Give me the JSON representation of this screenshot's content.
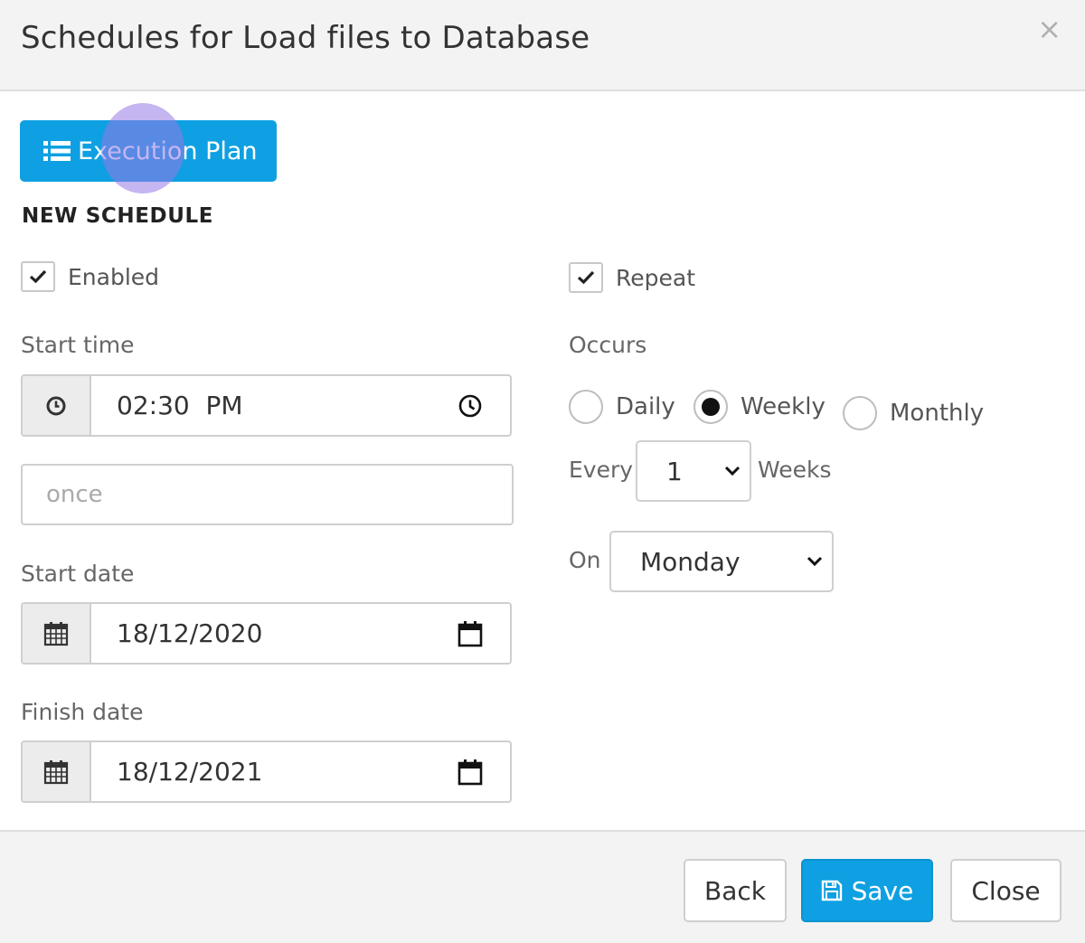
{
  "dialog": {
    "title": "Schedules for Load files to Database",
    "close_symbol": "×"
  },
  "toolbar": {
    "execution_plan_label": "Execution Plan",
    "execution_plan_icon": "list-icon"
  },
  "section": {
    "title": "NEW SCHEDULE"
  },
  "left": {
    "enabled_label": "Enabled",
    "enabled_checked": true,
    "start_time_label": "Start time",
    "start_time_value": "02:30  PM",
    "frequency_placeholder": "once",
    "start_date_label": "Start date",
    "start_date_value": "18/12/2020",
    "finish_date_label": "Finish date",
    "finish_date_value": "18/12/2021"
  },
  "right": {
    "repeat_label": "Repeat",
    "repeat_checked": true,
    "occurs_label": "Occurs",
    "options": [
      "Daily",
      "Weekly",
      "Monthly"
    ],
    "selected_option": "Weekly",
    "every_label": "Every",
    "every_value": "1",
    "weeks_label": "Weeks",
    "on_label": "On",
    "on_value": "Monday"
  },
  "footer": {
    "back_label": "Back",
    "save_label": "Save",
    "close_label": "Close"
  },
  "colors": {
    "primary": "#0ea0e2",
    "header_bg": "#f3f3f3",
    "click_indicator": "#9678e6"
  }
}
